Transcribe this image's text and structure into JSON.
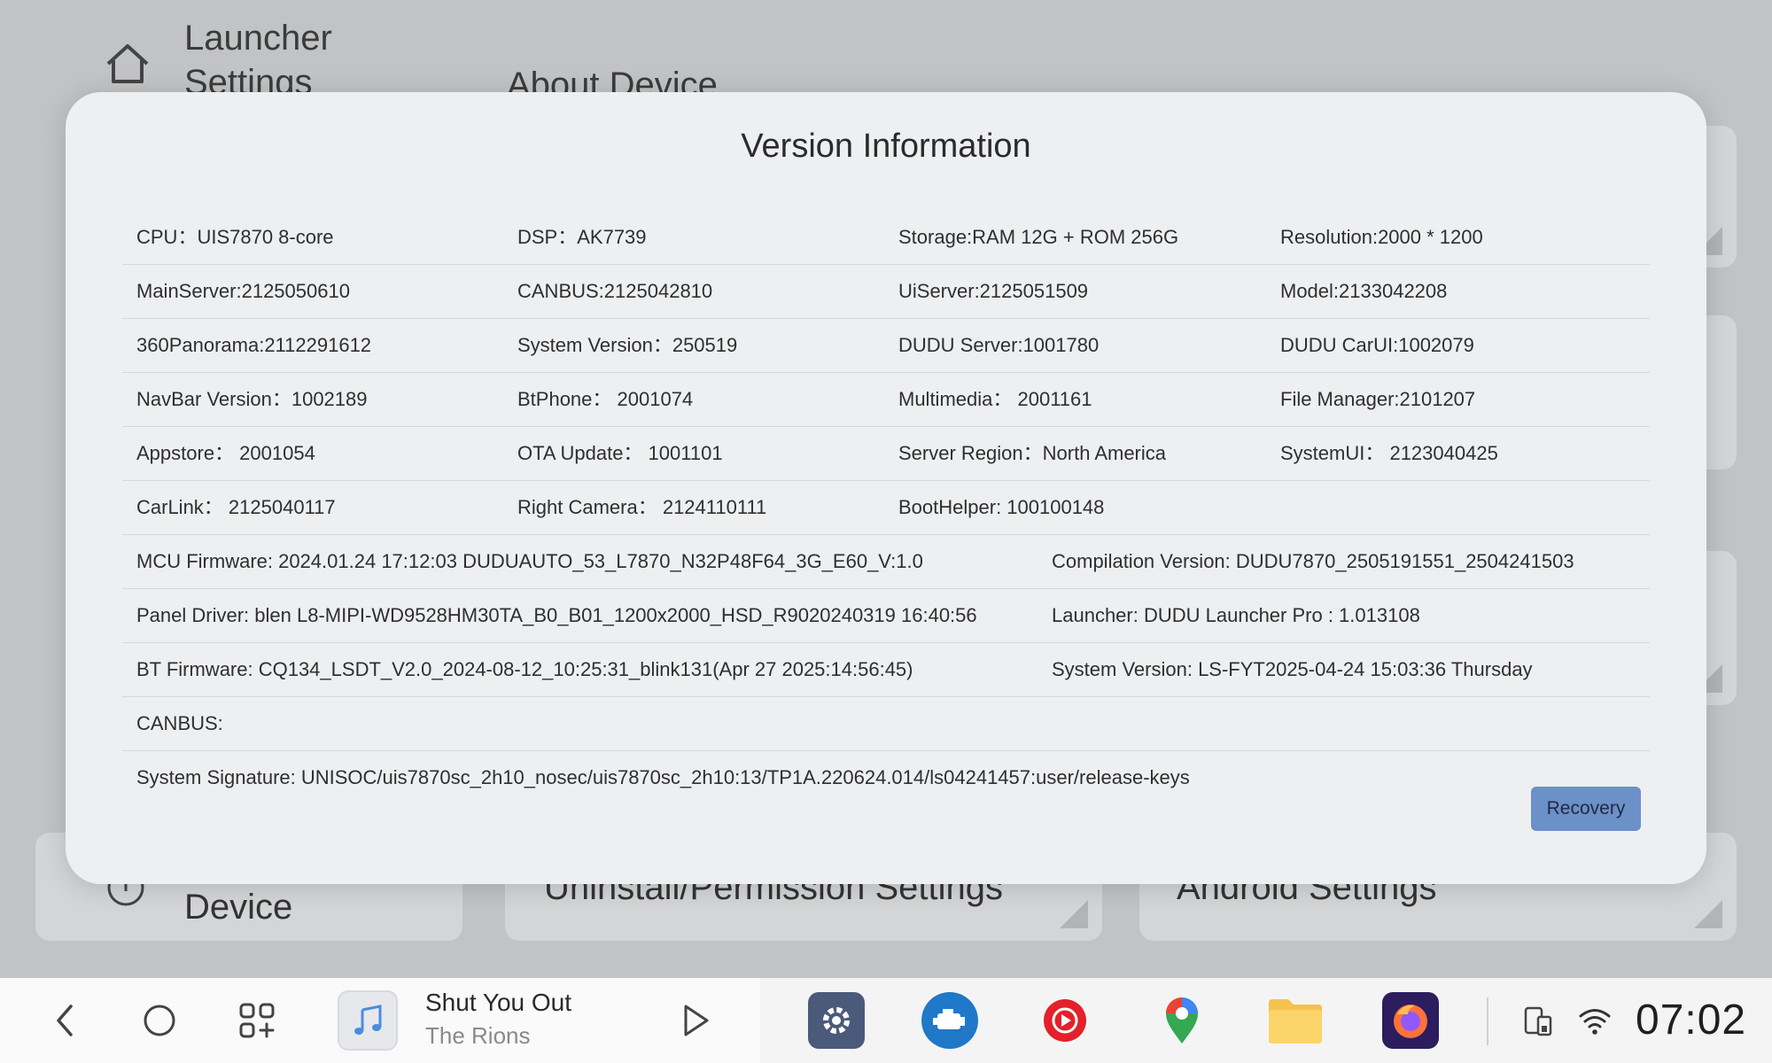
{
  "background": {
    "title": "Launcher Settings",
    "subtitle": "About Device",
    "card_device": "Device",
    "card_uninstall": "Uninstall/Permission Settings",
    "card_android": "Android Settings"
  },
  "dialog": {
    "title": "Version Information",
    "rows4": [
      [
        "CPU：UIS7870 8-core",
        "DSP：AK7739",
        "Storage:RAM 12G + ROM 256G",
        "Resolution:2000 * 1200"
      ],
      [
        "MainServer:2125050610",
        "CANBUS:2125042810",
        "UiServer:2125051509",
        "Model:2133042208"
      ],
      [
        "360Panorama:2112291612",
        "System Version：250519",
        "DUDU Server:1001780",
        "DUDU CarUI:1002079"
      ],
      [
        "NavBar Version：1002189",
        "BtPhone：  2001074",
        "Multimedia：  2001161",
        "File Manager:2101207"
      ],
      [
        "Appstore：  2001054",
        "OTA Update：  1001101",
        "Server Region：North America",
        "SystemUI：  2123040425"
      ],
      [
        "CarLink：  2125040117",
        "Right Camera：  2124110111",
        "BootHelper: 100100148",
        ""
      ]
    ],
    "rows2": [
      [
        "MCU Firmware:  2024.01.24 17:12:03 DUDUAUTO_53_L7870_N32P48F64_3G_E60_V:1.0",
        "Compilation Version:  DUDU7870_2505191551_2504241503"
      ],
      [
        "Panel Driver:  blen L8-MIPI-WD9528HM30TA_B0_B01_1200x2000_HSD_R9020240319 16:40:56",
        "Launcher:  DUDU Launcher Pro : 1.013108"
      ],
      [
        "BT Firmware:  CQ134_LSDT_V2.0_2024-08-12_10:25:31_blink131(Apr 27 2025:14:56:45)",
        "System Version:  LS-FYT2025-04-24 15:03:36 Thursday"
      ]
    ],
    "canbus": "CANBUS:",
    "signature": "System Signature:  UNISOC/uis7870sc_2h10_nosec/uis7870sc_2h10:13/TP1A.220624.014/ls04241457:user/release-keys",
    "recovery_label": "Recovery"
  },
  "taskbar": {
    "song_title": "Shut You Out",
    "song_artist": "The Rions",
    "time": "07:02",
    "apps": [
      "settings-app-icon",
      "car-engine-app-icon",
      "youtube-music-app-icon",
      "maps-app-icon",
      "files-app-icon",
      "firefox-app-icon"
    ]
  }
}
